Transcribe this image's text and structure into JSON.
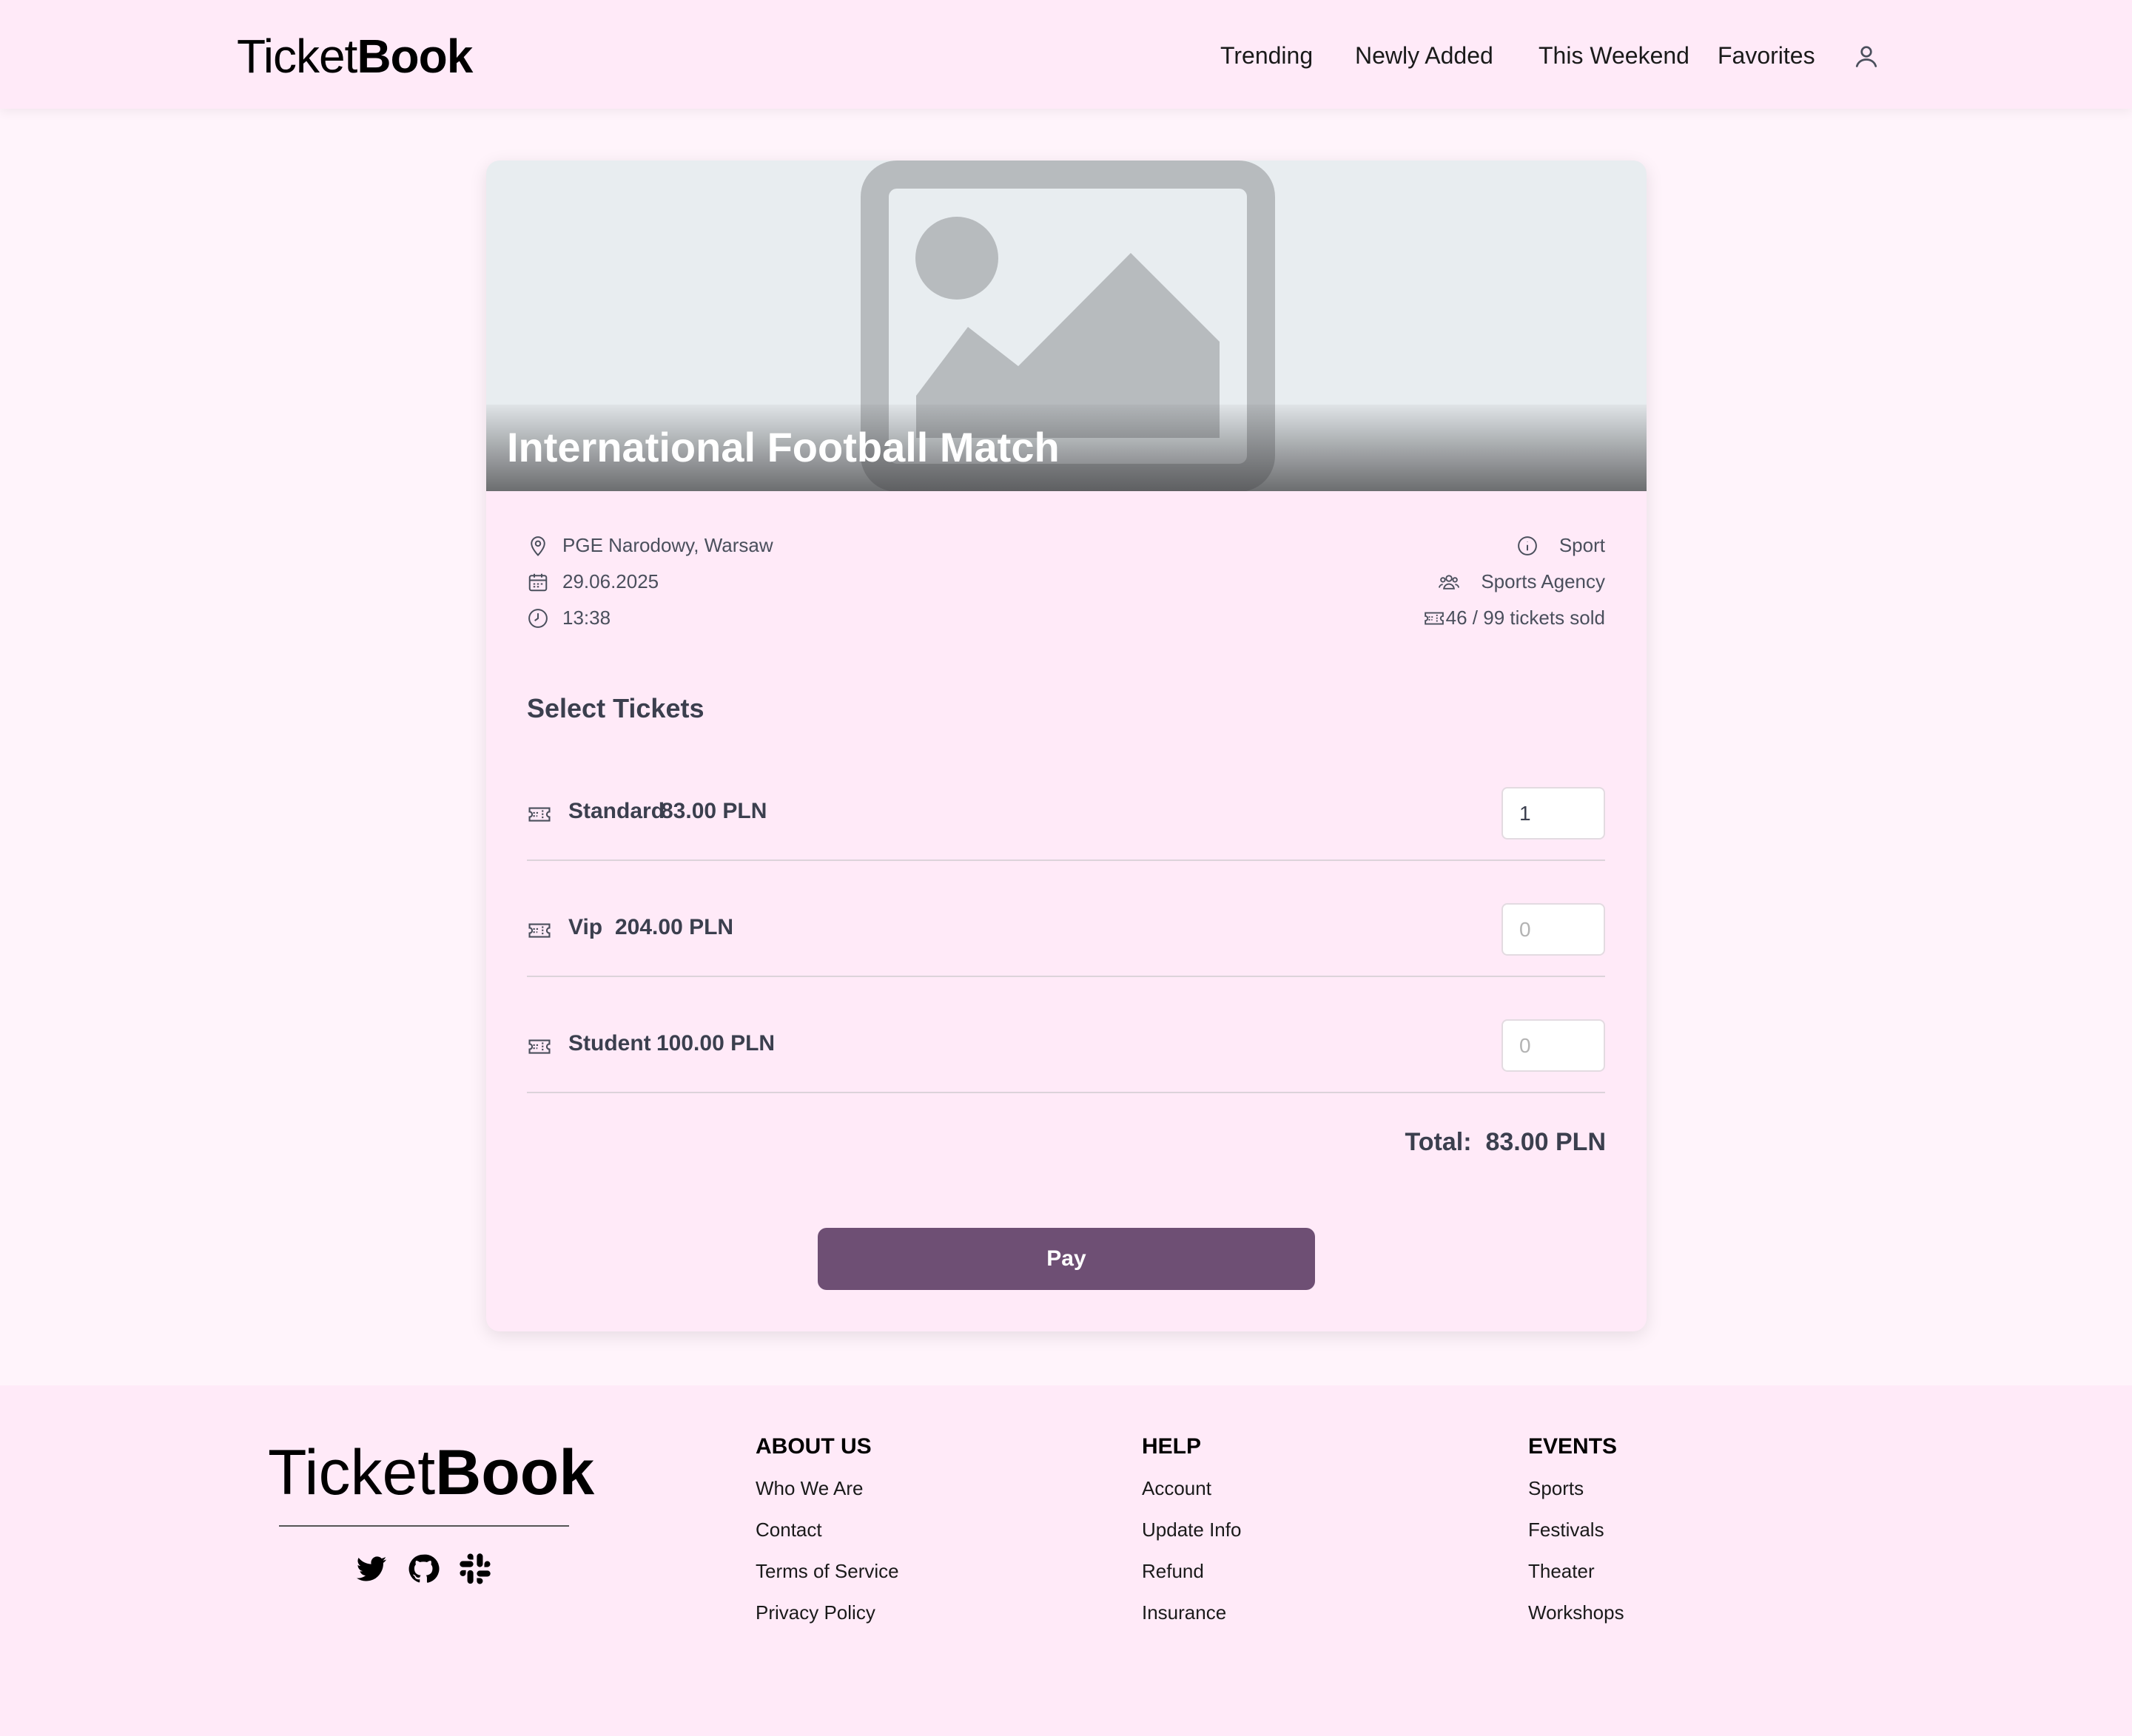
{
  "header": {
    "logo_light": "Ticket",
    "logo_bold": "Book",
    "nav": [
      "Trending",
      "Newly Added",
      "This Weekend",
      "Favorites"
    ],
    "user_icon": "user-icon"
  },
  "event": {
    "title": "International Football Match",
    "location": "PGE Narodowy, Warsaw",
    "date": "29.06.2025",
    "time": "13:38",
    "category": "Sport",
    "organizer": "Sports Agency",
    "tickets_sold": "46 / 99 tickets sold"
  },
  "tickets": {
    "section_title": "Select Tickets",
    "items": [
      {
        "name": "Standard",
        "price": "83.00 PLN",
        "quantity": "1",
        "placeholder": "0"
      },
      {
        "name": "Vip",
        "price": "204.00 PLN",
        "quantity": "",
        "placeholder": "0"
      },
      {
        "name": "Student",
        "price": "100.00 PLN",
        "quantity": "",
        "placeholder": "0"
      }
    ],
    "total_label": "Total:",
    "total_value": "83.00 PLN",
    "pay_label": "Pay"
  },
  "footer": {
    "logo_light": "Ticket",
    "logo_bold": "Book",
    "socials": [
      "twitter-icon",
      "github-icon",
      "slack-icon"
    ],
    "columns": [
      {
        "title": "ABOUT US",
        "links": [
          "Who We Are",
          "Contact",
          "Terms of Service",
          "Privacy Policy"
        ]
      },
      {
        "title": "HELP",
        "links": [
          "Account",
          "Update Info",
          "Refund",
          "Insurance"
        ]
      },
      {
        "title": "EVENTS",
        "links": [
          "Sports",
          "Festivals",
          "Theater",
          "Workshops"
        ]
      }
    ]
  },
  "colors": {
    "accent": "#6e4f74",
    "background": "#fff4fb",
    "surface": "#ffeaf8"
  }
}
